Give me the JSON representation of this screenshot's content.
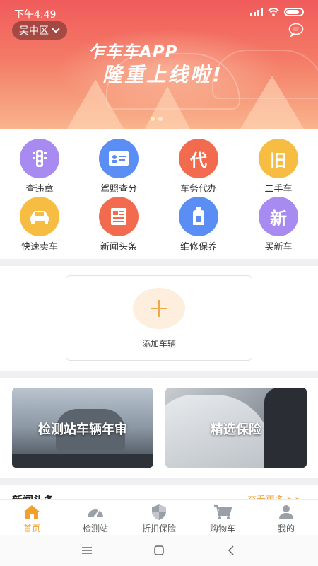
{
  "status": {
    "time": "下午4:49",
    "battery": "full"
  },
  "header": {
    "location": "吴中区",
    "message_icon": "chat-bubble-icon"
  },
  "banner": {
    "title_line1": "乍车车APP",
    "title_line2": "隆重上线啦!",
    "slide_count": 2,
    "active_slide": 0
  },
  "services": [
    {
      "label": "查违章",
      "icon": "traffic-light-icon",
      "color": "#a78bf0"
    },
    {
      "label": "驾照查分",
      "icon": "license-card-icon",
      "color": "#5b8ef5"
    },
    {
      "label": "车务代办",
      "icon": "代",
      "color": "#f36b4f"
    },
    {
      "label": "二手车",
      "icon": "旧",
      "color": "#f7bd42"
    },
    {
      "label": "快速卖车",
      "icon": "car-icon",
      "color": "#f7bd42"
    },
    {
      "label": "新闻头条",
      "icon": "newspaper-icon",
      "color": "#f36b4f"
    },
    {
      "label": "维修保养",
      "icon": "oil-can-icon",
      "color": "#5b8ef5"
    },
    {
      "label": "买新车",
      "icon": "新",
      "color": "#a78bf0"
    }
  ],
  "add_vehicle": {
    "label": "添加车辆"
  },
  "promos": [
    {
      "label": "检测站车辆年审"
    },
    {
      "label": "精选保险"
    }
  ],
  "news": {
    "title": "新闻头条",
    "more": "查看更多 >>"
  },
  "tabs": [
    {
      "label": "首页",
      "icon": "home-icon",
      "active": true
    },
    {
      "label": "检测站",
      "icon": "speedometer-icon",
      "active": false
    },
    {
      "label": "折扣保险",
      "icon": "shield-icon",
      "active": false
    },
    {
      "label": "购物车",
      "icon": "cart-icon",
      "active": false
    },
    {
      "label": "我的",
      "icon": "user-icon",
      "active": false
    }
  ],
  "accent": "#f2a02c"
}
